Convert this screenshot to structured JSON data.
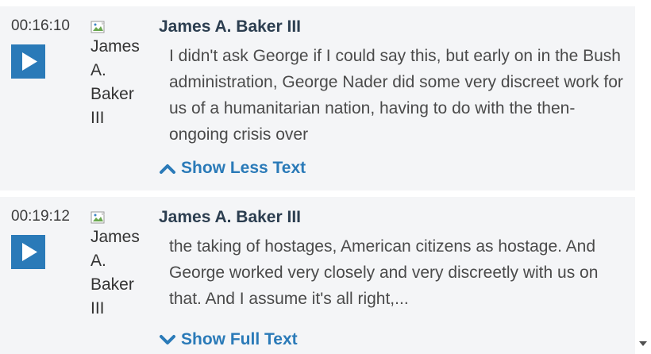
{
  "entries": [
    {
      "timestamp": "00:16:10",
      "speaker_image_alt": [
        "James",
        "A.",
        "Baker",
        "III"
      ],
      "speaker": "James A. Baker III",
      "text": "I didn't ask George if I could say this, but early on in the Bush administration, George Nader did some very discreet work for us of a humanitarian nation, having to do with the then-ongoing crisis over",
      "toggle_label": "Show Less Text",
      "toggle_icon": "chevron-up-icon"
    },
    {
      "timestamp": "00:19:12",
      "speaker_image_alt": [
        "James",
        "A.",
        "Baker",
        "III"
      ],
      "speaker": "James A. Baker III",
      "text": "the taking of hostages, American citizens as hostage. And George worked very closely and very discreetly with us on that. And I assume it's all right,...",
      "toggle_label": "Show Full Text",
      "toggle_icon": "chevron-down-icon"
    }
  ],
  "colors": {
    "accent": "#2a7ab8",
    "entry_background": "#f4f5f7",
    "speaker_name": "#2c3e50",
    "body_text": "#4a4a4a"
  },
  "icons": {
    "play": "play-icon",
    "broken_image": "broken-image-icon"
  }
}
